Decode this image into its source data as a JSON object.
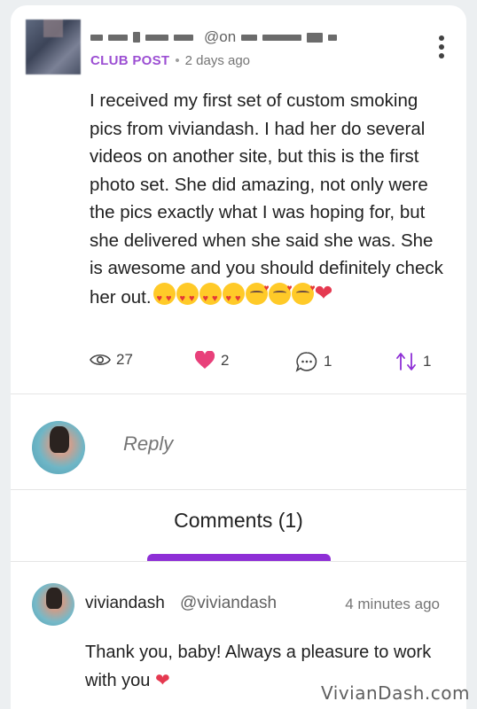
{
  "post": {
    "handle_fragment": "@on",
    "club_label": "CLUB POST",
    "separator": "•",
    "time": "2 days ago",
    "body": "I received my first set of custom smoking pics from viviandash.  I had her do several videos on another site, but this is the first photo set.  She did amazing, not only were the pics exactly what I was hoping for, but she delivered when she said she was.  She is awesome and you should definitely check her out.",
    "emojis": [
      "heart-eyes-emoji",
      "heart-eyes-emoji",
      "heart-eyes-emoji",
      "heart-eyes-emoji",
      "kissing-heart-emoji",
      "kissing-heart-emoji",
      "kissing-heart-emoji",
      "red-heart-emoji"
    ]
  },
  "stats": {
    "views": "27",
    "likes": "2",
    "comments": "1",
    "reposts": "1"
  },
  "reply": {
    "placeholder": "Reply"
  },
  "tabs": {
    "comments_label": "Comments (1)"
  },
  "comment": {
    "author": "viviandash",
    "handle": "@viviandash",
    "time": "4 minutes ago",
    "text": "Thank you, baby! Always a pleasure to work with you"
  },
  "watermark": "VivianDash.com",
  "colors": {
    "accent_purple": "#8e2fd6",
    "club_purple": "#9c4fd3",
    "like_pink": "#e8407a"
  }
}
